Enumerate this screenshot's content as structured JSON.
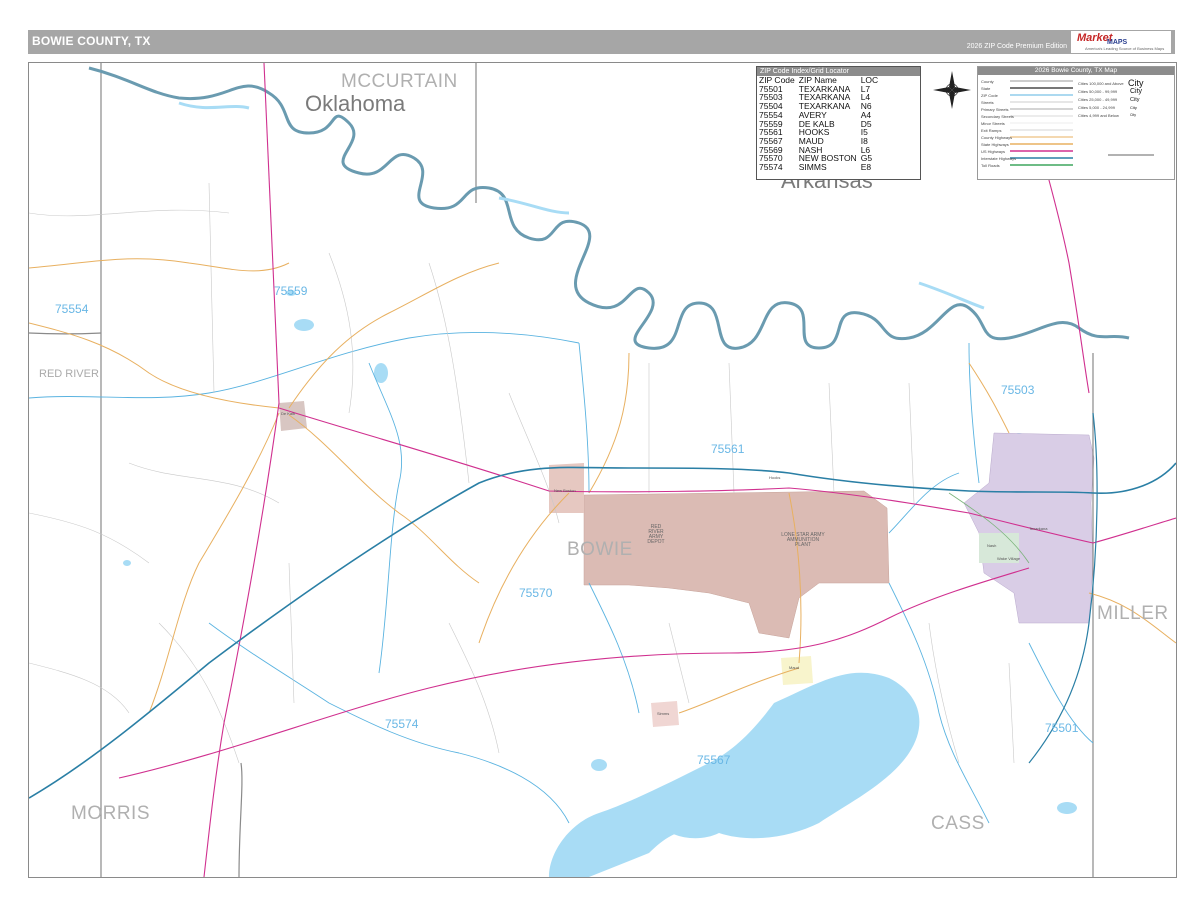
{
  "header": {
    "title": "BOWIE COUNTY, TX",
    "edition": "2026 ZIP Code Premium Edition",
    "logo": {
      "line1": "Market",
      "line2": "MAPS",
      "tagline": "America's Leading Source of Business Maps"
    }
  },
  "zip_index": {
    "header": "ZIP Code Index/Grid Locator",
    "columns": [
      "ZIP Code",
      "ZIP Name",
      "LOC"
    ],
    "rows": [
      [
        "75501",
        "TEXARKANA",
        "L7"
      ],
      [
        "75503",
        "TEXARKANA",
        "L4"
      ],
      [
        "75504",
        "TEXARKANA",
        "N6"
      ],
      [
        "75554",
        "AVERY",
        "A4"
      ],
      [
        "75559",
        "DE KALB",
        "D5"
      ],
      [
        "75561",
        "HOOKS",
        "I5"
      ],
      [
        "75567",
        "MAUD",
        "I8"
      ],
      [
        "75569",
        "NASH",
        "L6"
      ],
      [
        "75570",
        "NEW BOSTON",
        "G5"
      ],
      [
        "75574",
        "SIMMS",
        "E8"
      ]
    ]
  },
  "legend": {
    "header": "2026 Bowie County, TX Map",
    "items": [
      "County",
      "State",
      "ZIP Code",
      "Streets",
      "Primary Streets",
      "Secondary Streets",
      "Minor Streets",
      "Exit Ramps",
      "County Highways",
      "State Highways",
      "US Highways",
      "Interstate Highways",
      "Toll Roads"
    ],
    "city_sizes": [
      "Cities 100,000 and Above",
      "Cities 50,000 - 99,999",
      "Cities 25,000 - 49,999",
      "Cities 5,000 - 24,999",
      "Cities 4,999 and Below"
    ],
    "city_samples": [
      "City",
      "City",
      "City",
      "City",
      "City"
    ]
  },
  "map": {
    "states": [
      "Oklahoma",
      "Arkansas"
    ],
    "counties": [
      "MCCURTAIN",
      "RED RIVER",
      "BOWIE",
      "MILLER",
      "MORRIS",
      "CASS"
    ],
    "zip_labels": [
      "75559",
      "75554",
      "75561",
      "75503",
      "75570",
      "75574",
      "75567",
      "75501"
    ],
    "places": [
      "De Kalb",
      "New Boston",
      "Hooks",
      "Texarkana",
      "Nash",
      "Maud",
      "Simms",
      "Wake Village"
    ],
    "army_labels": [
      "RED RIVER ARMY DEPOT",
      "LONE STAR ARMY AMMUNITION PLANT"
    ],
    "colors": {
      "river": "#6a9bb0",
      "water": "#a8dcf5",
      "zip_line": "#5ab3e0",
      "us_highway": "#d0308f",
      "interstate": "#2a7fa5",
      "state_highway": "#e8b060",
      "army_area": "#dbbbb4",
      "urban_area": "#d9cde6",
      "header_bg": "#a6a6a6"
    }
  }
}
